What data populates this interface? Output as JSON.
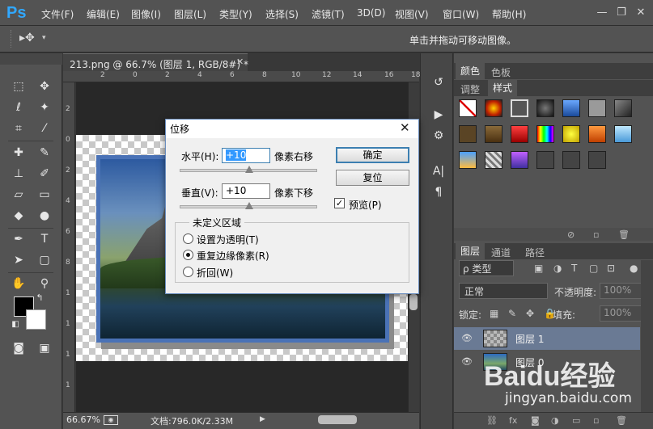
{
  "app": {
    "logo": "Ps"
  },
  "menu": [
    "文件(F)",
    "编辑(E)",
    "图像(I)",
    "图层(L)",
    "类型(Y)",
    "选择(S)",
    "滤镜(T)",
    "3D(D)",
    "视图(V)",
    "窗口(W)",
    "帮助(H)"
  ],
  "window_controls": {
    "minimize": "—",
    "restore": "❐",
    "close": "✕"
  },
  "options_bar": {
    "tool_glyph": "▸✥",
    "dropdown": "▾",
    "hint": "单击并拖动可移动图像。"
  },
  "document": {
    "tab_title": "213.png @ 66.7% (图层 1, RGB/8#) *",
    "tab_close": "✕",
    "ruler_top": [
      "2",
      "0",
      "2",
      "4",
      "6",
      "8",
      "10",
      "12",
      "14",
      "16",
      "18"
    ],
    "ruler_left": [
      "2",
      "0",
      "2",
      "4",
      "6",
      "8",
      "1",
      "1",
      "1",
      "1"
    ]
  },
  "status": {
    "zoom": "66.67%",
    "doc_size": "文档:796.0K/2.33M",
    "arrow": "▶"
  },
  "dialog": {
    "title": "位移",
    "close": "✕",
    "horizontal_label": "水平(H):",
    "horizontal_value": "+10",
    "horizontal_unit": "像素右移",
    "vertical_label": "垂直(V):",
    "vertical_value": "+10",
    "vertical_unit": "像素下移",
    "ok": "确定",
    "reset": "复位",
    "preview_label": "预览(P)",
    "preview_checked": true,
    "preview_check": "✓",
    "undefined_area_label": "未定义区域",
    "options": [
      {
        "label": "设置为透明(T)",
        "checked": false
      },
      {
        "label": "重复边缘像素(R)",
        "checked": true
      },
      {
        "label": "折回(W)",
        "checked": false
      }
    ]
  },
  "panels": {
    "color_tabs": [
      "颜色",
      "色板"
    ],
    "style_tabs": [
      "调整",
      "样式"
    ],
    "layers_tabs": [
      "图层",
      "通道",
      "路径"
    ],
    "filter_label": "ρ 类型",
    "blend_mode": "正常",
    "opacity_label": "不透明度:",
    "opacity_value": "100%",
    "lock_label": "锁定:",
    "fill_label": "填充:",
    "fill_value": "100%",
    "layers": [
      {
        "name": "图层 1",
        "selected": true
      },
      {
        "name": "图层 0",
        "selected": false
      }
    ],
    "eye_glyph": "👁"
  },
  "watermark": {
    "text": "Baidu经验",
    "url": "jingyan.baidu.com"
  }
}
